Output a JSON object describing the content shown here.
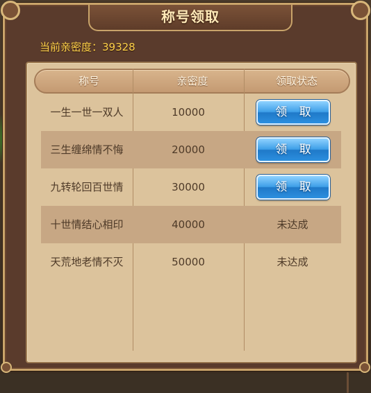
{
  "window": {
    "title": "称号领取",
    "intimacy_text": "当前亲密度：39328"
  },
  "table": {
    "headers": [
      "称号",
      "亲密度",
      "领取状态"
    ],
    "rows": [
      {
        "title": "一生一世一双人",
        "intimacy": "10000",
        "status_type": "button",
        "status": "领 取"
      },
      {
        "title": "三生缠绵情不悔",
        "intimacy": "20000",
        "status_type": "button",
        "status": "领 取"
      },
      {
        "title": "九转轮回百世情",
        "intimacy": "30000",
        "status_type": "button",
        "status": "领 取"
      },
      {
        "title": "十世情结心相印",
        "intimacy": "40000",
        "status_type": "text",
        "status": "未达成"
      },
      {
        "title": "天荒地老情不灭",
        "intimacy": "50000",
        "status_type": "text",
        "status": "未达成"
      }
    ]
  },
  "colors": {
    "title_text": "#ffe9b8",
    "intimacy_text": "#ffd24a",
    "button_blue": "#3e9fe8",
    "panel_bg": "#dcc39c",
    "row_dark": "#c7a784"
  }
}
